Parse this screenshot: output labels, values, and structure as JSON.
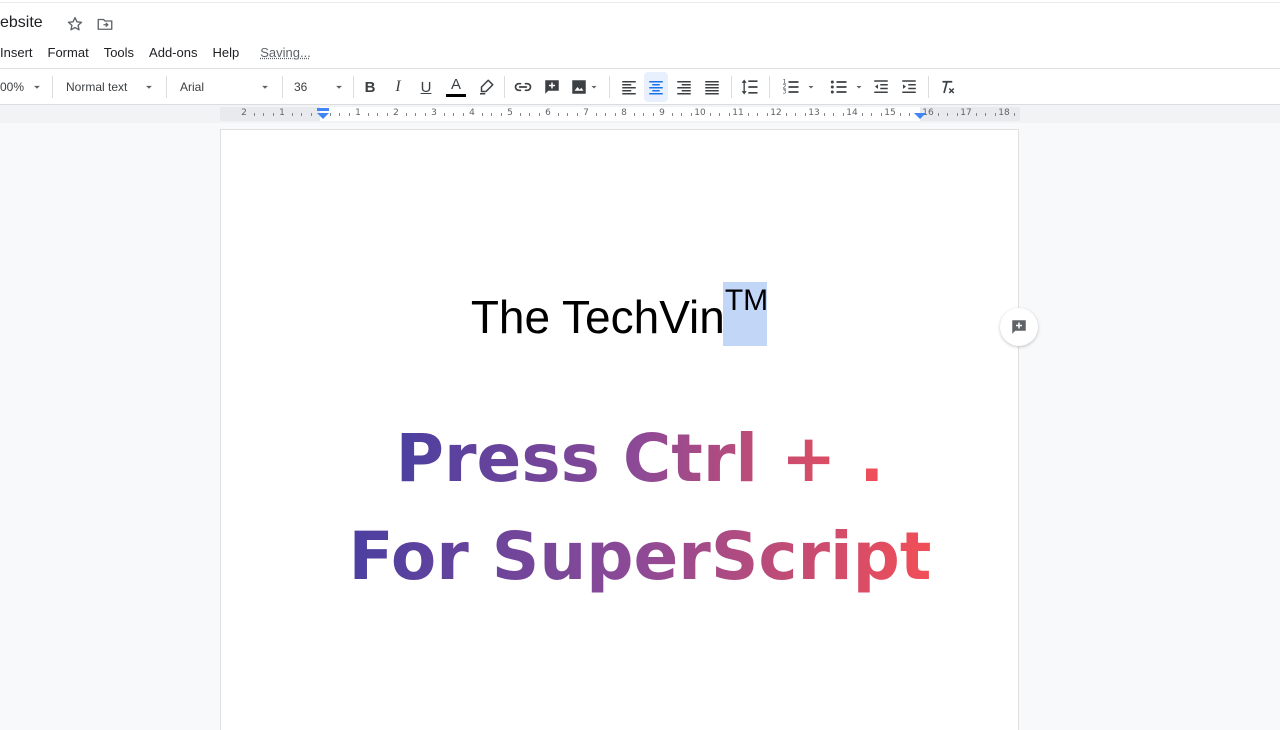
{
  "header": {
    "doc_title": "ebsite",
    "star_icon": "star-icon",
    "folder_icon": "move-to-folder-icon"
  },
  "menu": {
    "items": [
      "Insert",
      "Format",
      "Tools",
      "Add-ons",
      "Help"
    ],
    "saving": "Saving..."
  },
  "toolbar": {
    "zoom": "00%",
    "style": "Normal text",
    "font": "Arial",
    "font_size": "36",
    "icons": [
      "bold-icon",
      "italic-icon",
      "underline-icon",
      "text-color-icon",
      "highlight-icon",
      "link-icon",
      "add-comment-icon",
      "image-icon",
      "align-left-icon",
      "align-center-icon",
      "align-right-icon",
      "justify-icon",
      "line-spacing-icon",
      "numbered-list-icon",
      "bulleted-list-icon",
      "decrease-indent-icon",
      "increase-indent-icon",
      "clear-formatting-icon"
    ],
    "bold": "B",
    "italic": "I",
    "underline": "U",
    "text_color_letter": "A",
    "text_color": "#000000",
    "accent_color": "#1a73e8"
  },
  "ruler": {
    "numbers": [
      "2",
      "1",
      "1",
      "2",
      "3",
      "4",
      "5",
      "6",
      "7",
      "8",
      "9",
      "10",
      "11",
      "12",
      "13",
      "14",
      "15",
      "16",
      "17",
      "18"
    ]
  },
  "document": {
    "heading_main": "The TechVin",
    "heading_sup": "TM",
    "selection_color": "#c2d7f8"
  },
  "overlay": {
    "line1": "Press Ctrl + .",
    "line2": "For SuperScript",
    "gradient_start": "#4b3fa0",
    "gradient_end": "#f24e56"
  },
  "side": {
    "comment_icon": "add-comment-icon"
  }
}
